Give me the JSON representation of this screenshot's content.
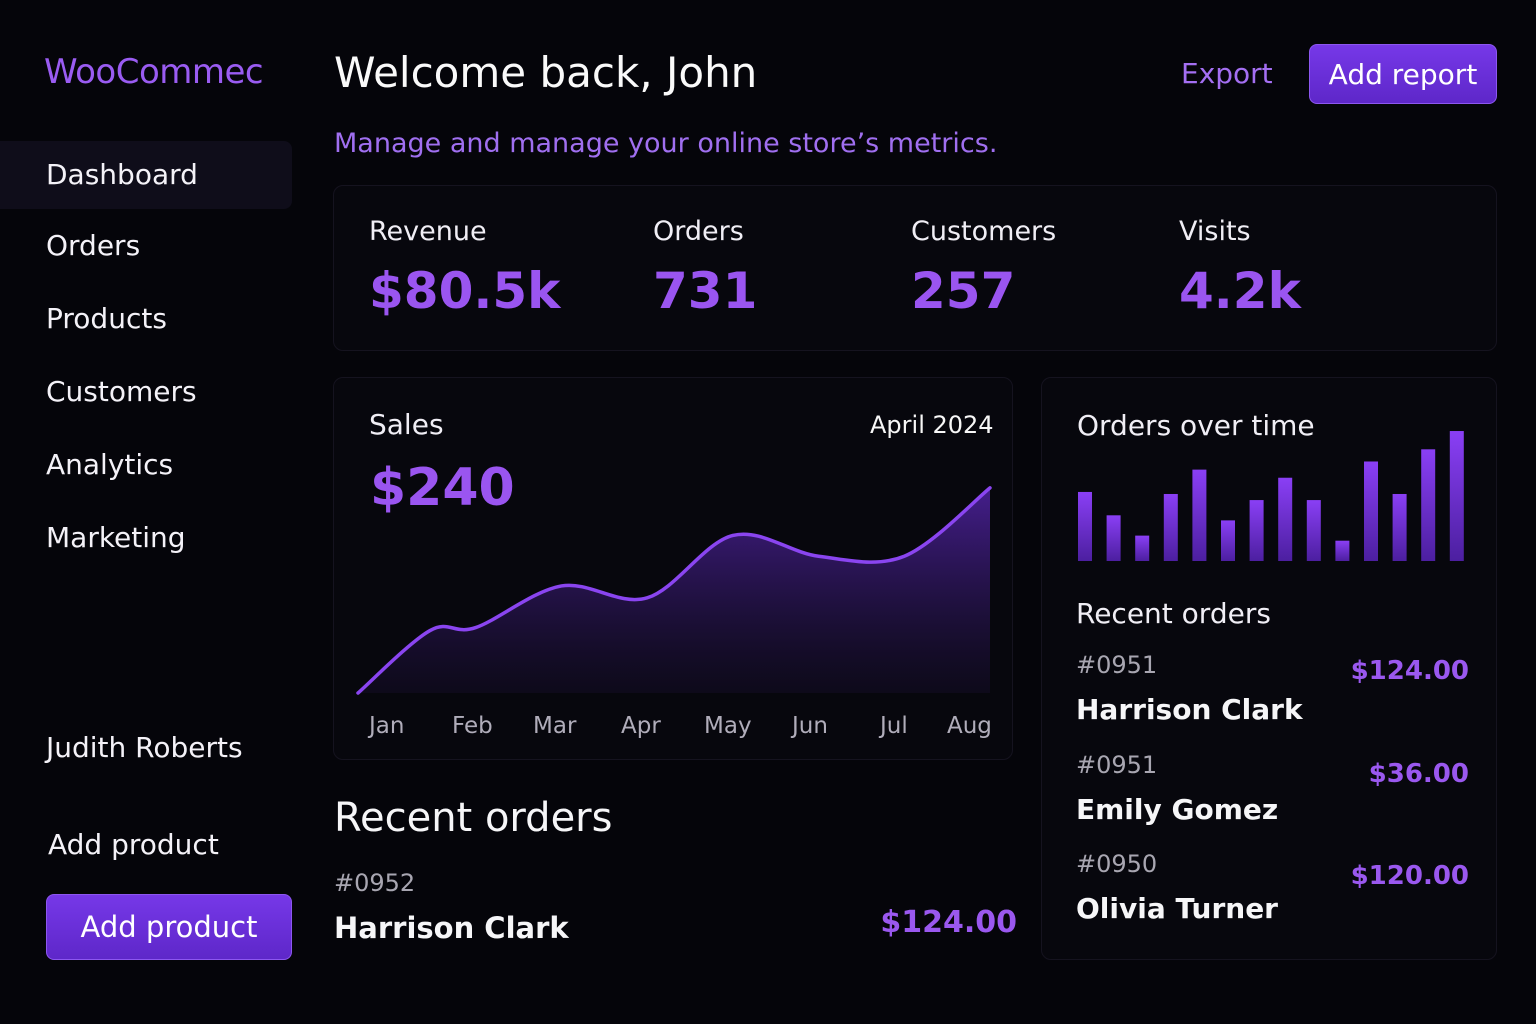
{
  "app": {
    "logo": "WooCommec"
  },
  "sidebar": {
    "items": [
      {
        "label": "Dashboard",
        "active": true
      },
      {
        "label": "Orders"
      },
      {
        "label": "Products"
      },
      {
        "label": "Customers"
      },
      {
        "label": "Analytics"
      },
      {
        "label": "Marketing"
      }
    ],
    "user_name": "Judith Roberts",
    "add_product_link": "Add product",
    "add_product_button": "Add product"
  },
  "header": {
    "title": "Welcome back, John",
    "subtitle": "Manage and manage your online store’s metrics.",
    "export_label": "Export",
    "add_report_label": "Add report"
  },
  "stats": [
    {
      "label": "Revenue",
      "value": "$80.5k"
    },
    {
      "label": "Orders",
      "value": "731"
    },
    {
      "label": "Customers",
      "value": "257"
    },
    {
      "label": "Visits",
      "value": "4.2k"
    }
  ],
  "sales": {
    "title": "Sales",
    "period": "April 2024",
    "value": "$240"
  },
  "orders_over_time": {
    "title": "Orders over time"
  },
  "recent_orders_side": {
    "title": "Recent orders",
    "orders": [
      {
        "id": "#0951",
        "name": "Harrison Clark",
        "amount": "$124.00"
      },
      {
        "id": "#0951",
        "name": "Emily Gomez",
        "amount": "$36.00"
      },
      {
        "id": "#0950",
        "name": "Olivia Turner",
        "amount": "$120.00"
      }
    ]
  },
  "recent_orders_main": {
    "title": "Recent orders",
    "order": {
      "id": "#0952",
      "name": "Harrison Clark",
      "amount": "$124.00"
    }
  },
  "colors": {
    "accent": "#7638e8",
    "accent_text": "#9a55f0",
    "background": "#05050a"
  },
  "chart_data": [
    {
      "type": "area",
      "categories": [
        "Jan",
        "Feb",
        "Mar",
        "Apr",
        "May",
        "Jun",
        "Jul",
        "Aug"
      ],
      "values": [
        0.42,
        0.44,
        0.72,
        0.64,
        1.06,
        0.92,
        0.92,
        1.38
      ],
      "ylim": [
        0,
        1.5
      ],
      "grid": false
    },
    {
      "type": "bar",
      "values": [
        68,
        45,
        25,
        66,
        90,
        40,
        60,
        82,
        60,
        20,
        98,
        66,
        110,
        128
      ],
      "ylim": [
        0,
        130
      ],
      "grid": false
    }
  ]
}
